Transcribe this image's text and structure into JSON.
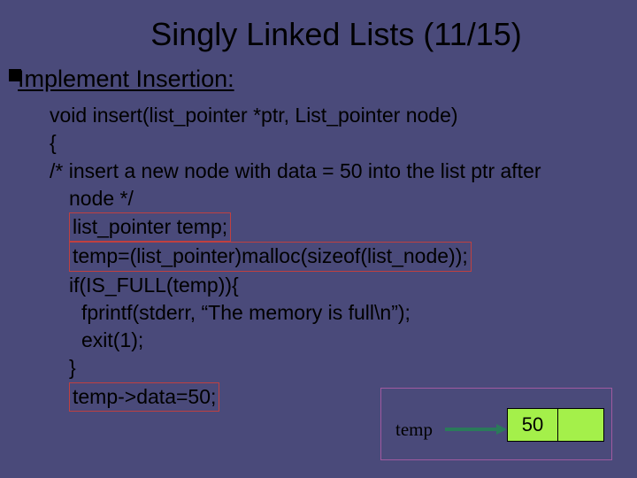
{
  "title": "Singly Linked Lists (11/15)",
  "subhead": "Implement Insertion:",
  "code": {
    "l1": "void insert(list_pointer *ptr, List_pointer node)",
    "l2": "{",
    "l3": "/* insert a new node with data = 50 into the list ptr after",
    "l3b": "node */",
    "l4": "list_pointer temp;",
    "l5": "temp=(list_pointer)malloc(sizeof(list_node));",
    "l6": "if(IS_FULL(temp)){",
    "l7": "fprintf(stderr, “The memory is full\\n”);",
    "l8": "exit(1);",
    "l9": "}",
    "l10": "temp->data=50;"
  },
  "diagram": {
    "temp_label": "temp",
    "node_value": "50"
  }
}
